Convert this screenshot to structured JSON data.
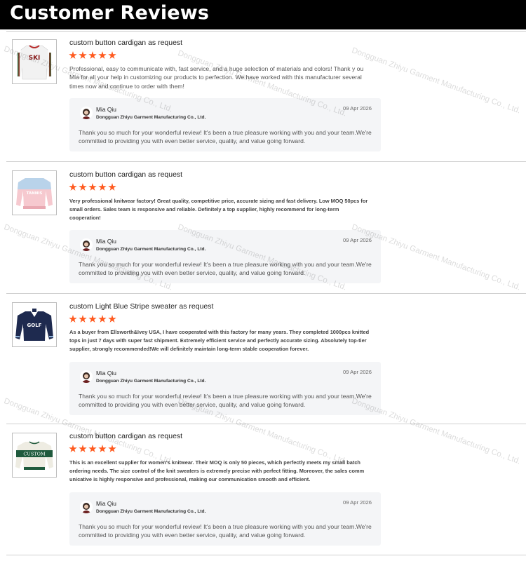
{
  "header": {
    "title": "Customer Reviews"
  },
  "watermark": "Dongguan Zhiyu Garment Manufacturing Co., Ltd.",
  "colors": {
    "star": "#ff5a1f",
    "header_bg": "#000000",
    "reply_bg": "#f4f5f7"
  },
  "reviews": [
    {
      "title": "custom button cardigan as request",
      "rating": 5,
      "product_image": "ski-cardigan",
      "product_text": "SKI",
      "body": "Professional, easy to communicate with, fast service, and a huge selection of materials and colors! Thank y ou Mia for all your help in customizing our products to perfection. We have worked with this manufacturer several times now and continue to order with them!",
      "reply": {
        "name": "Mia Qiu",
        "company": "Dongguan Zhiyu Garment Manufacturing Co., Ltd.",
        "date": "09 Apr 2026",
        "text": "Thank you so much for your wonderful review! It's been a true pleasure working with you and your team.We're committed to providing you with even better service, quality, and value going forward."
      }
    },
    {
      "title": "custom button cardigan as request",
      "rating": 5,
      "product_image": "pink-blue-sweater",
      "product_text": "TANNIS",
      "body": "Very professional knitwear factory! Great quality, competitive price, accurate sizing and fast delivery. Low MOQ 50pcs for small orders. Sales team is responsive and reliable. Definitely a top supplier, highly recommend for long-term cooperation!",
      "reply": {
        "name": "Mia Qiu",
        "company": "Dongguan Zhiyu Garment Manufacturing Co., Ltd.",
        "date": "09 Apr 2026",
        "text": "Thank you so much for your wonderful review! It's been a true pleasure working with you and your team.We're committed to providing you with even better service, quality, and value going forward."
      }
    },
    {
      "title": "custom Light Blue Stripe sweater as request",
      "rating": 5,
      "product_image": "navy-golf-sweater",
      "product_text": "GOLF",
      "body": "As a buyer from Ellsworth&Ivey USA, I have cooperated with this factory for many years. They completed 1000pcs knitted tops in just 7 days with super fast shipment. Extremely efficient service and perfectly accurate sizing. Absolutely top-tier supplier, strongly recommended!We will definitely maintain long-term stable cooperation forever.",
      "reply": {
        "name": "Mia Qiu",
        "company": "Dongguan Zhiyu Garment Manufacturing Co., Ltd.",
        "date": "09 Apr 2026",
        "text": "Thank you so much for your wonderful review! It's been a true pleasure working with you and your team.We're committed to providing you with even better service, quality, and value going forward."
      }
    },
    {
      "title": "custom button cardigan as request",
      "rating": 5,
      "product_image": "cream-custom-sweater",
      "product_text": "CUSTOM",
      "body": "This is an excellent supplier for women's knitwear. Their MOQ is only 50 pieces, which perfectly meets my small batch ordering needs. The size control of the knit sweaters is extremely precise with perfect fitting. Moreover, the sales comm unicative is highly responsive and professional, making our communication smooth and efficient.",
      "reply": {
        "name": "Mia Qiu",
        "company": "Dongguan Zhiyu Garment Manufacturing Co., Ltd.",
        "date": "09 Apr 2026",
        "text": "Thank you so much for your wonderful review! It's been a true pleasure working with you and your team.We're committed to providing you with even better service, quality, and value going forward."
      }
    }
  ]
}
